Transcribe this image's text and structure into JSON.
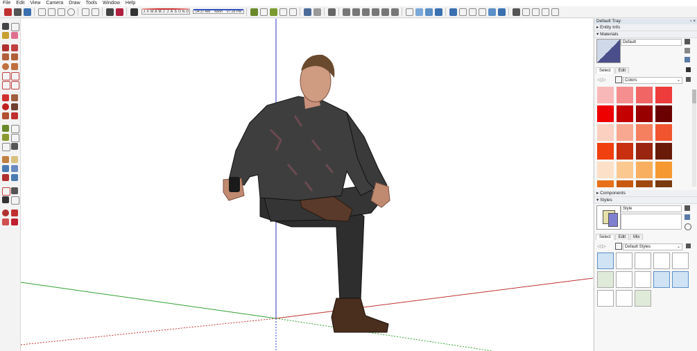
{
  "menu": [
    "File",
    "Edit",
    "View",
    "Camera",
    "Draw",
    "Tools",
    "Window",
    "Help"
  ],
  "shadow": {
    "months": [
      "J",
      "F",
      "M",
      "A",
      "M",
      "J",
      "J",
      "A",
      "S",
      "O",
      "N",
      "D"
    ],
    "time_start": "04:37 AM",
    "time_mid": "Noon",
    "time_end": "07:28 PM"
  },
  "tray": {
    "title": "Default Tray",
    "entity_info": "Entity Info",
    "materials": "Materials",
    "material_name": "Default",
    "tab_select": "Select",
    "tab_edit": "Edit",
    "collection": "Colors",
    "components": "Components",
    "styles": "Styles",
    "style_name": "Style",
    "styles_tab_select": "Select",
    "styles_tab_edit": "Edit",
    "styles_tab_mix": "Mix",
    "styles_collection": "Default Styles"
  },
  "colors": {
    "accent": "#5a8fc7",
    "palette": [
      [
        "#f9b8b8",
        "#f58f8f",
        "#f26565",
        "#ee3b3b"
      ],
      [
        "#ee0000",
        "#c40000",
        "#980000",
        "#6b0000"
      ],
      [
        "#fbd0c0",
        "#f8a890",
        "#f58060",
        "#f05530"
      ],
      [
        "#f04010",
        "#c83010",
        "#9a2510",
        "#6a1a08"
      ],
      [
        "#fde0c8",
        "#fbc890",
        "#f8b060",
        "#f59830"
      ],
      [
        "#e8701a",
        "#c85a10",
        "#a04a10",
        "#7a3a10"
      ]
    ]
  }
}
